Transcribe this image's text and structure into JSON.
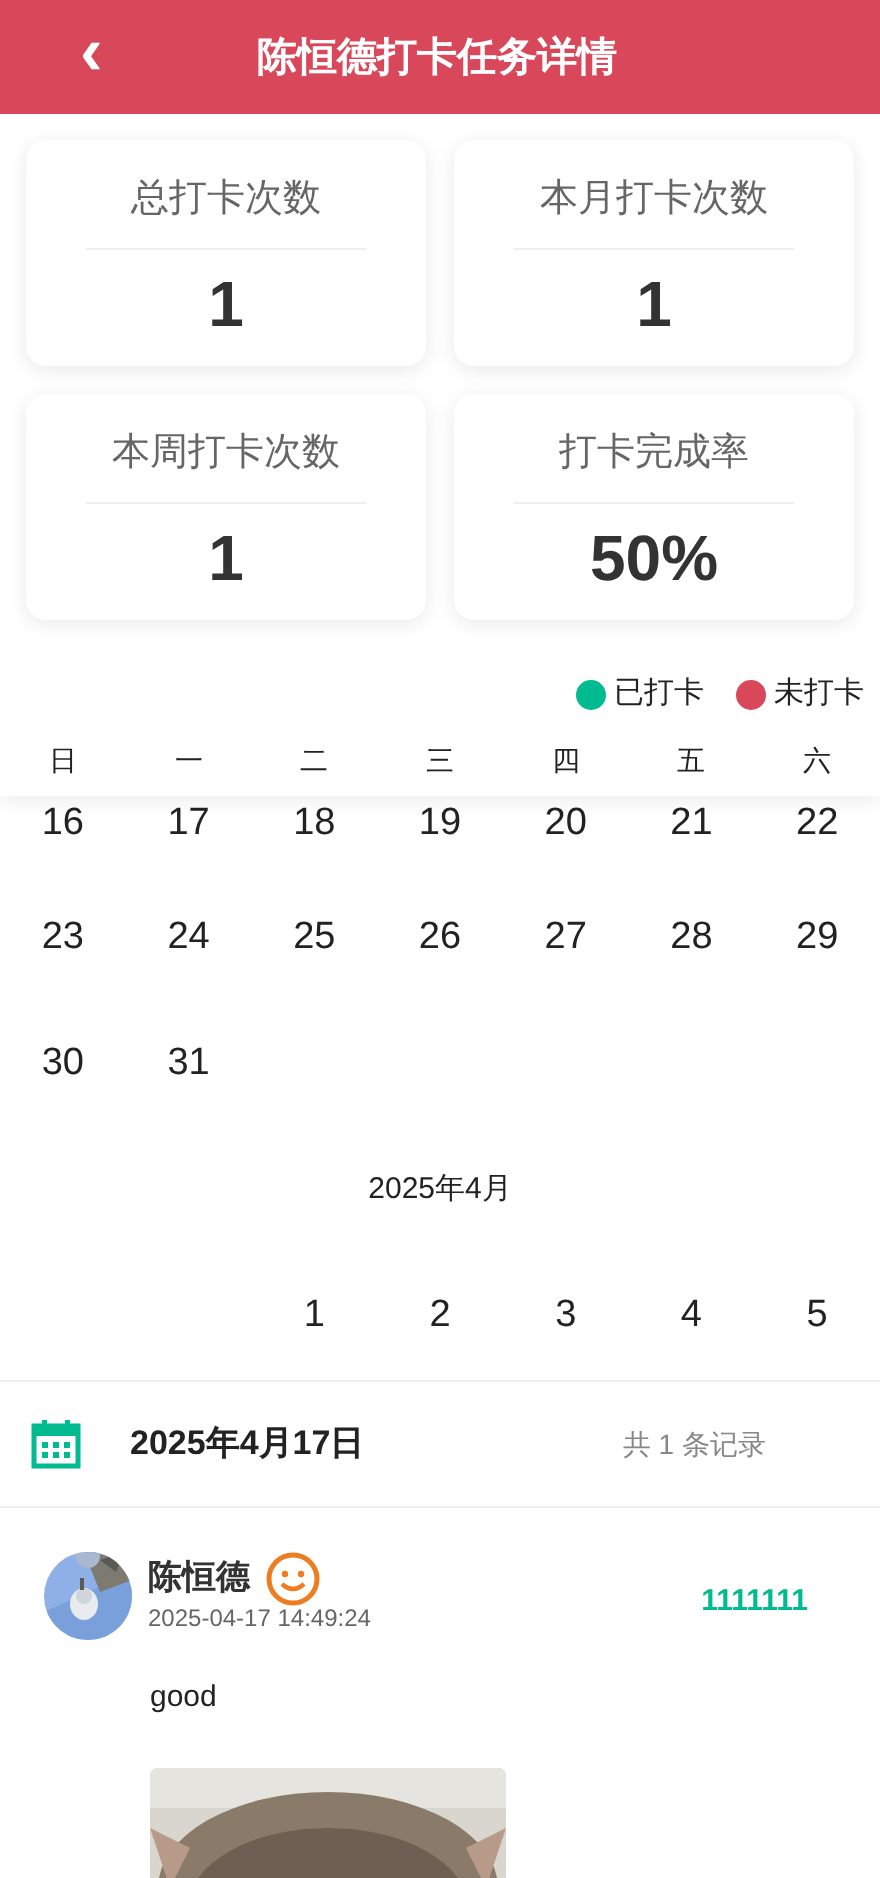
{
  "header": {
    "back": "‹",
    "title": "陈恒德打卡任务详情"
  },
  "stats": [
    {
      "label": "总打卡次数",
      "value": "1"
    },
    {
      "label": "本月打卡次数",
      "value": "1"
    },
    {
      "label": "本周打卡次数",
      "value": "1"
    },
    {
      "label": "打卡完成率",
      "value": "50%"
    }
  ],
  "legend": [
    {
      "label": "已打卡",
      "color": "#00bb8f"
    },
    {
      "label": "未打卡",
      "color": "#d9485a"
    }
  ],
  "weekdays": [
    "日",
    "一",
    "二",
    "三",
    "四",
    "五",
    "六"
  ],
  "calendar": [
    {
      "kind": "week",
      "days": [
        "16",
        "17",
        "18",
        "19",
        "20",
        "21",
        "22"
      ]
    },
    {
      "kind": "week",
      "days": [
        "23",
        "24",
        "25",
        "26",
        "27",
        "28",
        "29"
      ]
    },
    {
      "kind": "week",
      "days": [
        "30",
        "31"
      ]
    },
    {
      "kind": "month",
      "label": "2025年4月"
    },
    {
      "kind": "week",
      "days": [
        "1",
        "2",
        "3",
        "4",
        "5"
      ]
    }
  ],
  "day_header": {
    "date": "2025年4月17日",
    "count": "共 1 条记录"
  },
  "records": [
    {
      "name": "陈恒德",
      "time": "2025-04-17 14:49:24",
      "score": "1111111",
      "text": "good"
    }
  ]
}
